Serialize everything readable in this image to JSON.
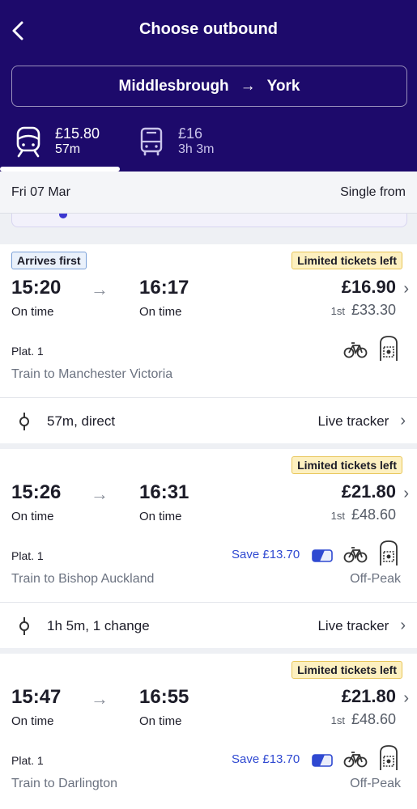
{
  "header": {
    "title": "Choose outbound",
    "route": {
      "origin": "Middlesbrough",
      "arrow": "→",
      "destination": "York"
    },
    "modes": [
      {
        "icon": "train-icon",
        "price": "£15.80",
        "duration": "57m",
        "selected": true
      },
      {
        "icon": "bus-icon",
        "price": "£16",
        "duration": "3h 3m",
        "selected": false
      }
    ]
  },
  "date_bar": {
    "date": "Fri 07 Mar",
    "fare_label": "Single from"
  },
  "journeys": [
    {
      "tags": [
        "Arrives first",
        "Limited tickets left"
      ],
      "depart": "15:20",
      "arrive": "16:17",
      "depart_status": "On time",
      "arrive_status": "On time",
      "price": "£16.90",
      "first_class_label": "1st",
      "first_class_price": "£33.30",
      "platform": "Plat. 1",
      "destination": "Train to Manchester Victoria",
      "save": "",
      "fare_type": "",
      "summary": "57m, direct",
      "tracker": "Live tracker"
    },
    {
      "tags": [
        "Limited tickets left"
      ],
      "depart": "15:26",
      "arrive": "16:31",
      "depart_status": "On time",
      "arrive_status": "On time",
      "price": "£21.80",
      "first_class_label": "1st",
      "first_class_price": "£48.60",
      "platform": "Plat. 1",
      "destination": "Train to Bishop Auckland",
      "save": "Save £13.70",
      "fare_type": "Off-Peak",
      "summary": "1h 5m, 1 change",
      "tracker": "Live tracker"
    },
    {
      "tags": [
        "Limited tickets left"
      ],
      "depart": "15:47",
      "arrive": "16:55",
      "depart_status": "On time",
      "arrive_status": "On time",
      "price": "£21.80",
      "first_class_label": "1st",
      "first_class_price": "£48.60",
      "platform": "Plat. 1",
      "destination": "Train to Darlington",
      "save": "Save £13.70",
      "fare_type": "Off-Peak"
    }
  ],
  "colors": {
    "header_bg": "#1d0a6b",
    "save_blue": "#2f49d1",
    "limited_bg": "#fdf0c0",
    "arrives_first_bg": "#eaf1fb"
  },
  "icons": [
    "back-chevron-icon",
    "train-icon",
    "bus-icon",
    "bicycle-icon",
    "seat-reservation-icon",
    "railcard-icon",
    "route-stop-icon",
    "chevron-right-icon"
  ]
}
